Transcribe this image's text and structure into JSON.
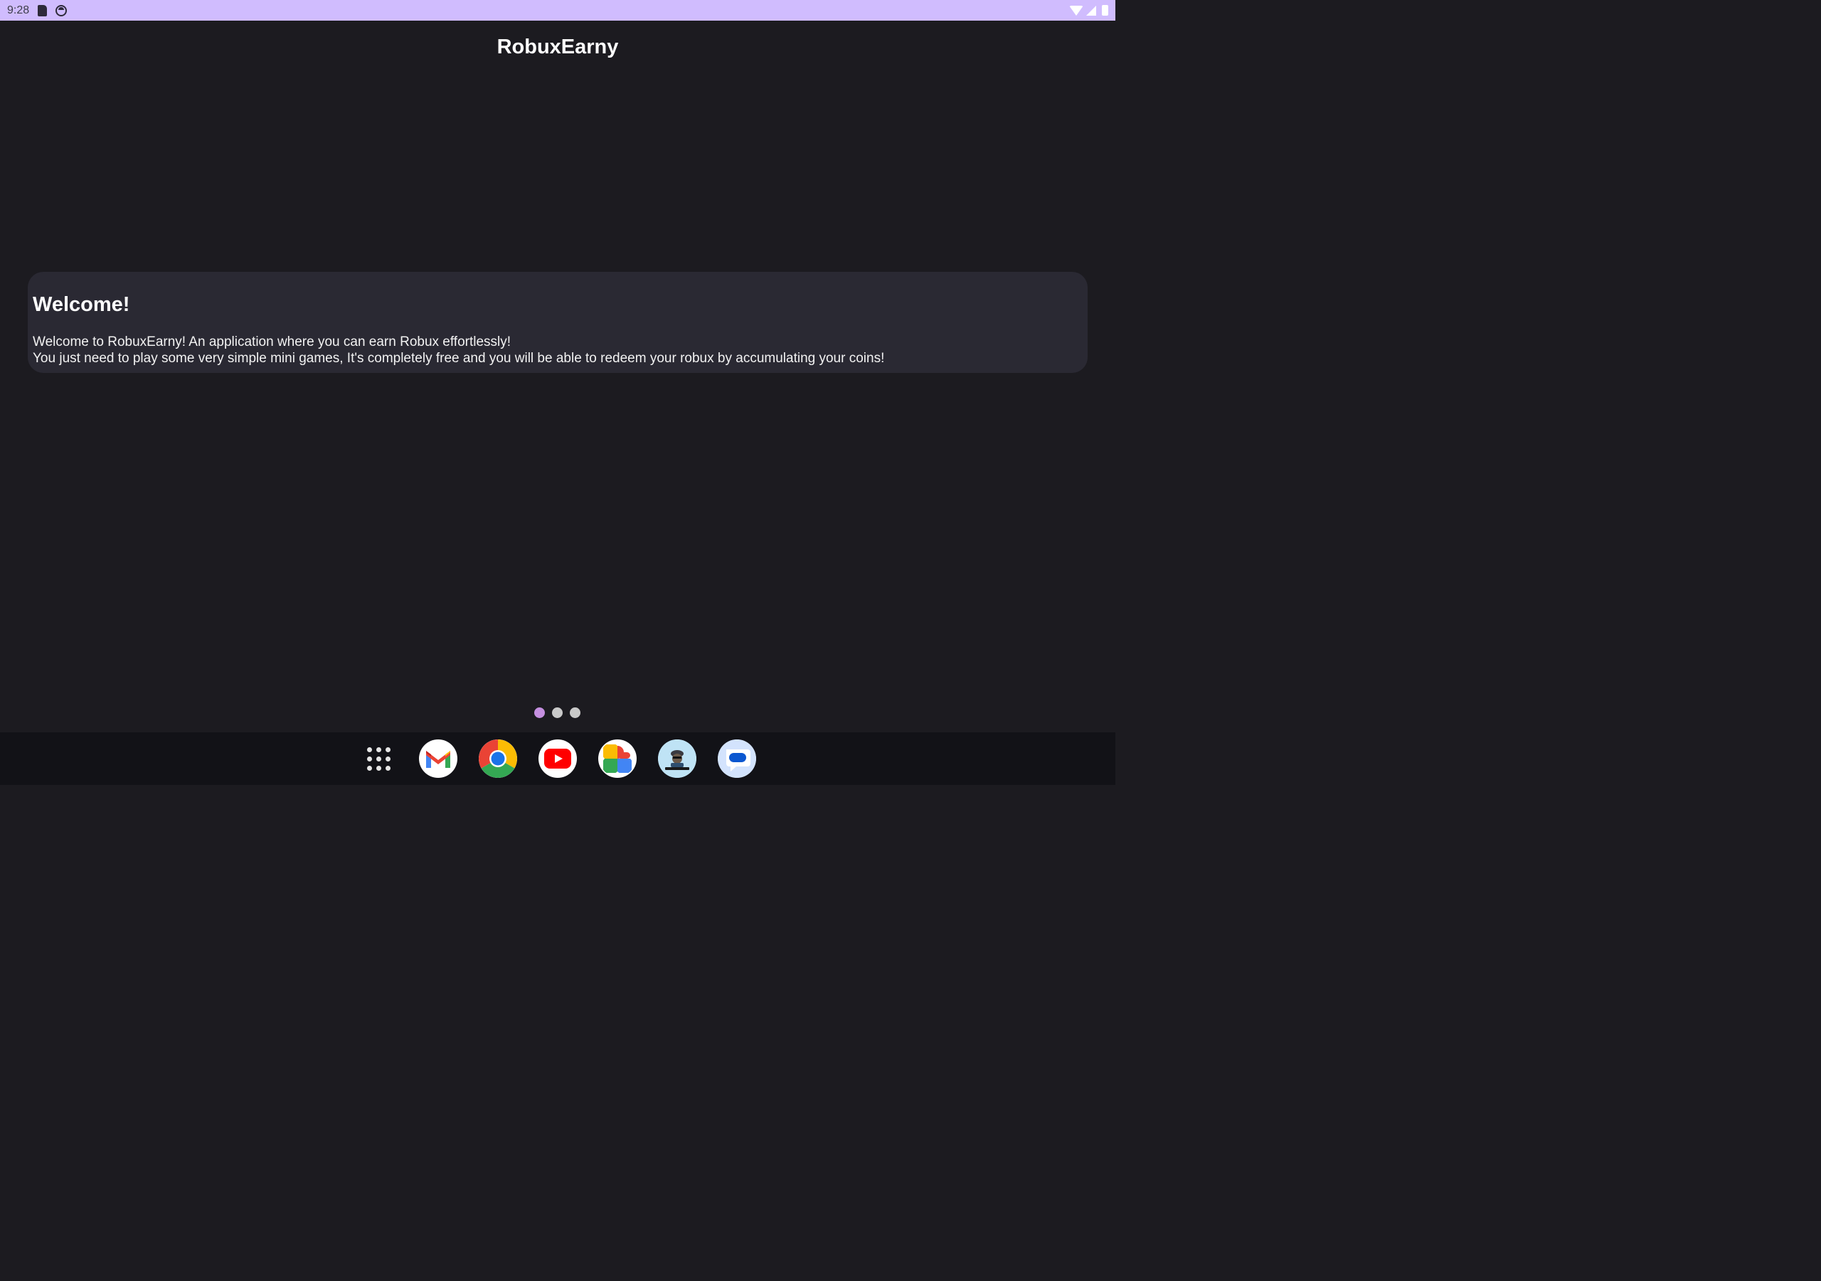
{
  "status_bar": {
    "time": "9:28",
    "left_icons": [
      "sd-card-icon",
      "face-icon"
    ],
    "right_icons": [
      "wifi-icon",
      "signal-icon",
      "battery-icon"
    ]
  },
  "app": {
    "title": "RobuxEarny"
  },
  "card": {
    "title": "Welcome!",
    "line1": "Welcome to RobuxEarny! An application where you can earn Robux effortlessly!",
    "line2": "You just need to play some very simple mini games, It's completely free and you will be able to redeem your robux by accumulating your coins!"
  },
  "pager": {
    "pages": 3,
    "active_index": 0
  },
  "dock": {
    "apps": [
      "all-apps-icon",
      "gmail-icon",
      "chrome-icon",
      "youtube-icon",
      "photos-icon",
      "robuxearny-icon",
      "messages-icon"
    ]
  },
  "colors": {
    "status_bar": "#d0bcfe",
    "background": "#1c1b20",
    "card": "#2a2933",
    "active_dot": "#c58fe0"
  }
}
